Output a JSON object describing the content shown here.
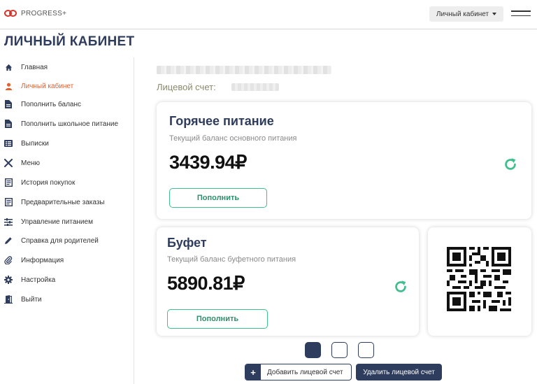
{
  "header": {
    "brand": "PROGRESS+",
    "account_menu": "Личный кабинет"
  },
  "page": {
    "title": "ЛИЧНЫЙ КАБИНЕТ"
  },
  "sidebar": {
    "items": [
      {
        "label": "Главная",
        "icon": "home-icon"
      },
      {
        "label": "Личный кабинет",
        "icon": "user-icon",
        "active": true
      },
      {
        "label": "Пополнить баланс",
        "icon": "document-icon"
      },
      {
        "label": "Пополнить школьное питание",
        "icon": "document-icon"
      },
      {
        "label": "Выписки",
        "icon": "list-icon"
      },
      {
        "label": "Меню",
        "icon": "utensils-icon"
      },
      {
        "label": "История покупок",
        "icon": "receipt-icon"
      },
      {
        "label": "Предварительные заказы",
        "icon": "receipt-icon"
      },
      {
        "label": "Управление питанием",
        "icon": "sliders-icon"
      },
      {
        "label": "Справка для родителей",
        "icon": "pencil-icon"
      },
      {
        "label": "Информация",
        "icon": "paperclip-icon"
      },
      {
        "label": "Настройка",
        "icon": "gear-icon"
      },
      {
        "label": "Выйти",
        "icon": "exit-icon"
      }
    ]
  },
  "account": {
    "label": "Лицевой счет:"
  },
  "hot_meal": {
    "title": "Горячее питание",
    "subtitle": "Текущий баланс основного питания",
    "amount": "3439.94₽",
    "button": "Пополнить"
  },
  "buffet": {
    "title": "Буфет",
    "subtitle": "Текущий баланс буфетного питания",
    "amount": "5890.81₽",
    "button": "Пополнить"
  },
  "pager": {
    "count": 3,
    "active": 1
  },
  "actions": {
    "add_plus": "+",
    "add_label": "Добавить лицевой счет",
    "delete_label": "Удалить лицевой счет"
  },
  "colors": {
    "brand_navy": "#2e3c5e",
    "accent_green": "#3fbf8e",
    "active_orange": "#e2612e",
    "logo_red": "#d9342b"
  }
}
